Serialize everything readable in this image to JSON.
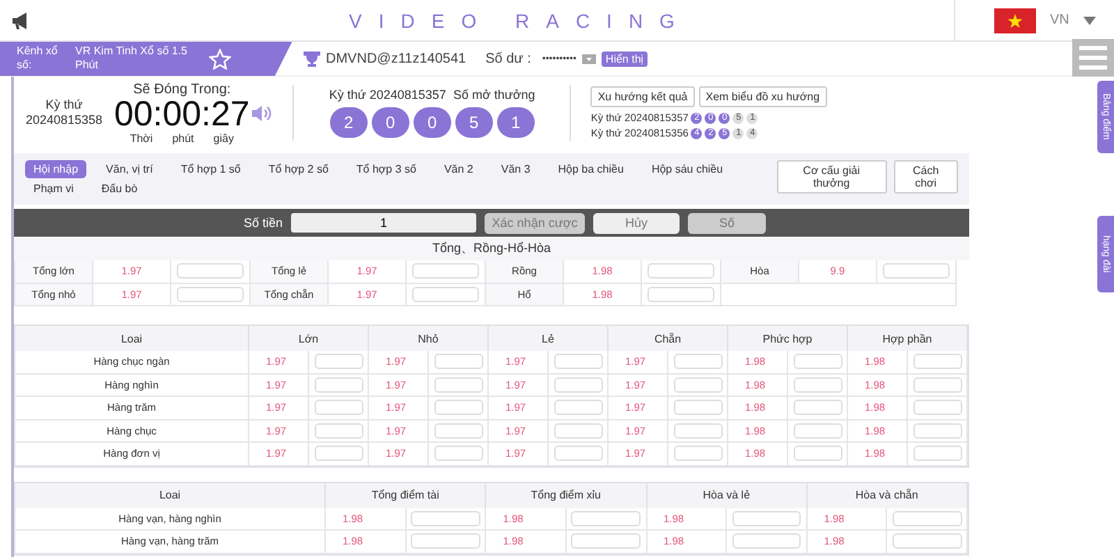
{
  "header": {
    "title": "VIDEO RACING",
    "language": "VN"
  },
  "channel": {
    "label": "Kênh xổ số:",
    "name": "VR Kim Tinh Xổ số 1.5 Phút",
    "favorite": false
  },
  "account": {
    "user": "DMVND@z11z140541",
    "balance_label": "Số dư :",
    "balance": "••••••••••",
    "show_button": "Hiển thị"
  },
  "draw": {
    "period_label": "Kỳ thứ",
    "period": "20240815358",
    "countdown_label": "Sẽ Đóng Trong:",
    "time": "00:00:27",
    "units": [
      "Thời",
      "phút",
      "giây"
    ]
  },
  "last_result": {
    "label": "Kỳ thứ 20240815357  Số mở thưởng",
    "balls": [
      "2",
      "0",
      "0",
      "5",
      "1"
    ]
  },
  "trend_buttons": [
    "Xu hướng kết quả",
    "Xem biểu đồ xu hướng"
  ],
  "history": [
    {
      "label": "Kỳ thứ 20240815357",
      "balls": [
        {
          "value": "2",
          "highlighted": true
        },
        {
          "value": "0",
          "highlighted": true
        },
        {
          "value": "0",
          "highlighted": true
        },
        {
          "value": "5",
          "highlighted": false
        },
        {
          "value": "1",
          "highlighted": false
        }
      ]
    },
    {
      "label": "Kỳ thứ 20240815356",
      "balls": [
        {
          "value": "4",
          "highlighted": true
        },
        {
          "value": "2",
          "highlighted": true
        },
        {
          "value": "5",
          "highlighted": true
        },
        {
          "value": "1",
          "highlighted": false
        },
        {
          "value": "4",
          "highlighted": false
        }
      ]
    }
  ],
  "bet_tabs": [
    {
      "label": "Hội nhập",
      "selected": true
    },
    {
      "label": "Văn, vị trí",
      "selected": false
    },
    {
      "label": "Tổ hợp 1 số",
      "selected": false
    },
    {
      "label": "Tổ hợp 2 số",
      "selected": false
    },
    {
      "label": "Tổ hợp 3 số",
      "selected": false
    },
    {
      "label": "Văn 2",
      "selected": false
    },
    {
      "label": "Văn 3",
      "selected": false
    },
    {
      "label": "Hộp ba chiều",
      "selected": false
    },
    {
      "label": "Hộp sáu chiều",
      "selected": false
    },
    {
      "label": "Phạm vi",
      "selected": false
    },
    {
      "label": "Đấu bò",
      "selected": false
    }
  ],
  "help_buttons": [
    "Cơ cấu giải thưởng",
    "Cách chơi"
  ],
  "bet_bar": {
    "amount_label": "Số tiền",
    "amount": "1",
    "buttons": [
      "Xác nhận cược",
      "Hủy",
      "Số"
    ]
  },
  "summary": {
    "title": "Tổng、Rồng-Hổ-Hòa",
    "rows": [
      [
        {
          "label": "Tổng lớn",
          "odds": "1.97"
        },
        {
          "label": "Tổng lẻ",
          "odds": "1.97"
        },
        {
          "label": "Rồng",
          "odds": "1.98"
        },
        {
          "label": "Hòa",
          "odds": "9.9"
        }
      ],
      [
        {
          "label": "Tổng nhỏ",
          "odds": "1.97"
        },
        {
          "label": "Tổng chẵn",
          "odds": "1.97"
        },
        {
          "label": "Hổ",
          "odds": "1.98"
        }
      ]
    ]
  },
  "tables": [
    {
      "columns": [
        "Loai",
        "Lớn",
        "Nhỏ",
        "Lẻ",
        "Chẵn",
        "Phức hợp",
        "Hợp phần"
      ],
      "rows": [
        {
          "label": "Hàng chục ngàn",
          "odds": [
            "1.97",
            "1.97",
            "1.97",
            "1.97",
            "1.98",
            "1.98"
          ]
        },
        {
          "label": "Hàng nghìn",
          "odds": [
            "1.97",
            "1.97",
            "1.97",
            "1.97",
            "1.98",
            "1.98"
          ]
        },
        {
          "label": "Hàng trăm",
          "odds": [
            "1.97",
            "1.97",
            "1.97",
            "1.97",
            "1.98",
            "1.98"
          ]
        },
        {
          "label": "Hàng chục",
          "odds": [
            "1.97",
            "1.97",
            "1.97",
            "1.97",
            "1.98",
            "1.98"
          ]
        },
        {
          "label": "Hàng đơn vị",
          "odds": [
            "1.97",
            "1.97",
            "1.97",
            "1.97",
            "1.98",
            "1.98"
          ]
        }
      ]
    },
    {
      "columns": [
        "Loai",
        "Tổng điểm tài",
        "Tổng điểm xỉu",
        "Hòa và lẻ",
        "Hòa và chẵn"
      ],
      "rows": [
        {
          "label": "Hàng vạn, hàng nghìn",
          "odds": [
            "1.98",
            "1.98",
            "1.98",
            "1.98"
          ]
        },
        {
          "label": "Hàng vạn, hàng trăm",
          "odds": [
            "1.98",
            "1.98",
            "1.98",
            "1.98"
          ]
        }
      ]
    }
  ],
  "side_tabs": [
    "Bảng điểm",
    "hạng đài"
  ]
}
